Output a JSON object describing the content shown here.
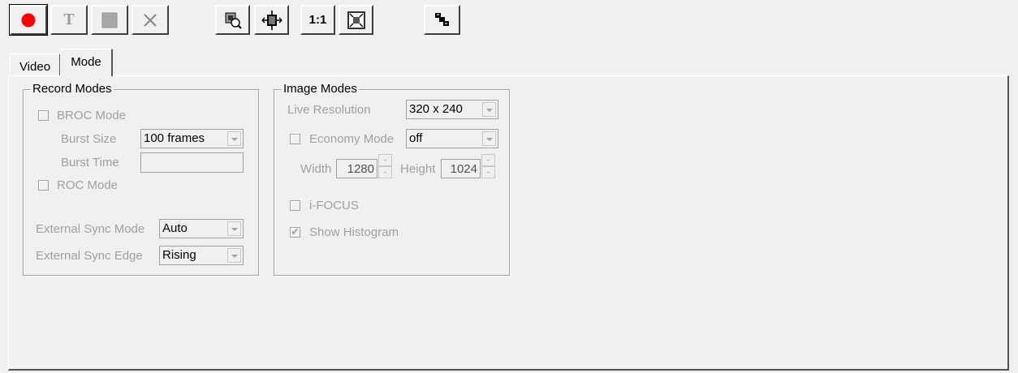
{
  "toolbar": {
    "record_icon": "record-icon",
    "text_icon": "T",
    "stop_icon": "stop-icon",
    "close_icon": "close-icon",
    "zoom_fit_icon": "zoom-icon",
    "center_icon": "center-icon",
    "actual_size_label": "1:1",
    "fit_window_icon": "fit-window-icon",
    "arrange_icon": "arrange-icon",
    "record_color": "#ff0000"
  },
  "tabs": [
    {
      "label": "Video",
      "active": false
    },
    {
      "label": "Mode",
      "active": true
    }
  ],
  "record_modes": {
    "title": "Record Modes",
    "broc_mode": {
      "label": "BROC Mode",
      "checked": false
    },
    "burst_size": {
      "label": "Burst Size",
      "value": "100 frames"
    },
    "burst_time": {
      "label": "Burst Time",
      "value": ""
    },
    "roc_mode": {
      "label": "ROC Mode",
      "checked": false
    },
    "ext_sync_mode": {
      "label": "External Sync Mode",
      "value": "Auto"
    },
    "ext_sync_edge": {
      "label": "External Sync Edge",
      "value": "Rising"
    }
  },
  "image_modes": {
    "title": "Image Modes",
    "live_resolution": {
      "label": "Live Resolution",
      "value": "320 x 240"
    },
    "economy_mode": {
      "label": "Economy Mode",
      "value": "off",
      "checked": false
    },
    "width": {
      "label": "Width",
      "value": "1280"
    },
    "height": {
      "label": "Height",
      "value": "1024"
    },
    "ifocus": {
      "label": "i-FOCUS",
      "checked": false
    },
    "show_histogram": {
      "label": "Show Histogram",
      "checked": true,
      "mark": "✔"
    }
  }
}
